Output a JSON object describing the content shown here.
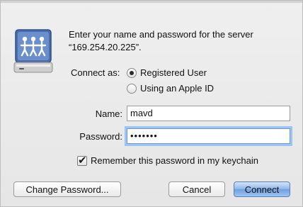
{
  "message": {
    "line1": "Enter your name and password for the server",
    "line2": "“169.254.20.225”."
  },
  "connect_as": {
    "label": "Connect as:",
    "options": [
      {
        "label": "Registered User",
        "selected": true
      },
      {
        "label": "Using an Apple ID",
        "selected": false
      }
    ]
  },
  "name_field": {
    "label": "Name:",
    "value": "mavd"
  },
  "password_field": {
    "label": "Password:",
    "value": "•••••••"
  },
  "remember": {
    "label": "Remember this password in my keychain",
    "checked": true
  },
  "buttons": {
    "change_password": "Change Password...",
    "cancel": "Cancel",
    "connect": "Connect"
  },
  "icons": {
    "server": "network-server-icon",
    "check": "✔"
  },
  "colors": {
    "default_button": "#6fa0e2",
    "focus_ring": "#9ec4f0",
    "icon_blue": "#4a6fae"
  }
}
